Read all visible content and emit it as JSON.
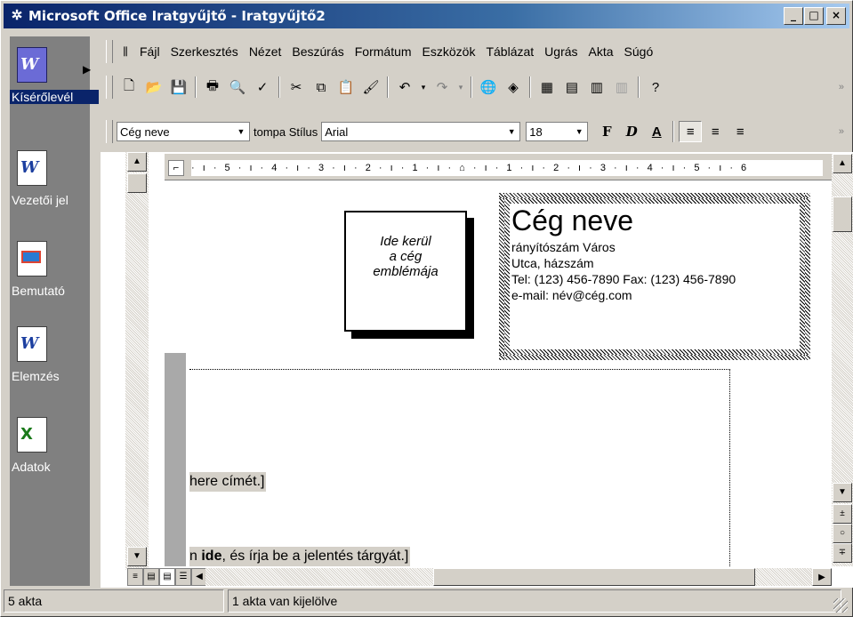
{
  "window": {
    "title": "Microsoft Office Iratgyűjtő - Iratgyűjtő2",
    "minimize": "_",
    "maximize": "□",
    "close": "×"
  },
  "sidebar": {
    "items": [
      {
        "label": "Kísérőlevél",
        "icon": "word-doc-icon",
        "glyph": "W",
        "active": true
      },
      {
        "label": "Vezetői jel",
        "icon": "word-doc-icon",
        "glyph": "W",
        "active": false
      },
      {
        "label": "Bemutató",
        "icon": "powerpoint-doc-icon",
        "glyph": "",
        "active": false
      },
      {
        "label": "Elemzés",
        "icon": "word-doc-icon",
        "glyph": "W",
        "active": false
      },
      {
        "label": "Adatok",
        "icon": "excel-doc-icon",
        "glyph": "X",
        "active": false
      }
    ]
  },
  "menu": {
    "items": [
      "Fájl",
      "Szerkesztés",
      "Nézet",
      "Beszúrás",
      "Formátum",
      "Eszközök",
      "Táblázat",
      "Ugrás",
      "Akta",
      "Súgó"
    ]
  },
  "formatting": {
    "style_value": "Cég neve",
    "style_label": "tompa Stílus",
    "font_value": "Arial",
    "size_value": "18",
    "bold": "F",
    "italic": "D",
    "underline": "A"
  },
  "ruler": {
    "horizontal": "· ı · 5 · ı · 4 · ı · 3 · ı · 2 · ı · 1 · ı · ⌂ · ı · 1 · ı · 2 · ı · 3 · ı · 4 · ı · 5 · ı · 6"
  },
  "document": {
    "logo_text": [
      "Ide kerül",
      "a cég",
      "emblémája"
    ],
    "company_name": "Cég neve",
    "address_line1": "rányítószám Város",
    "address_line2": "Utca, házszám",
    "phone_fax": "Tel: (123) 456-7890 Fax: (123) 456-7890",
    "email": "e-mail: név@cég.com",
    "line1": "here címét.]",
    "line2_pre": "n ",
    "line2_bold": "ide",
    "line2_post": ", és írja be a jelentés tárgyát.]"
  },
  "status": {
    "count": "5 akta",
    "selection": "1 akta van kijelölve"
  },
  "colors": {
    "titlebar_start": "#0a246a",
    "titlebar_end": "#a6caf0",
    "face": "#d4d0c8"
  }
}
